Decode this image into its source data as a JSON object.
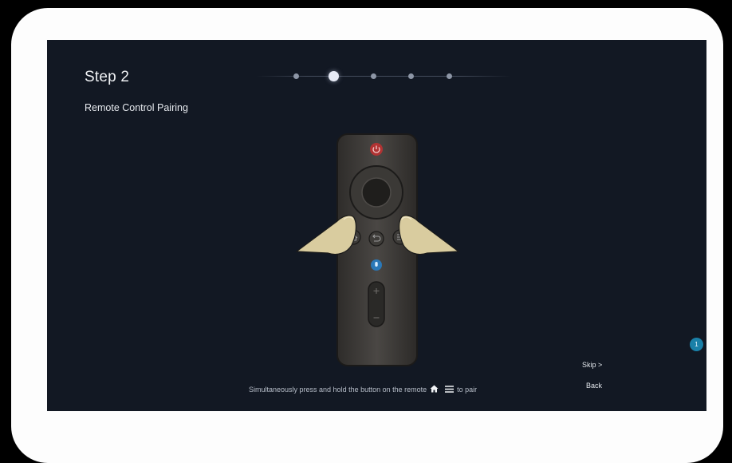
{
  "setup": {
    "title": "Step 2",
    "subtitle": "Remote Control Pairing",
    "progress": {
      "current_step": 2,
      "total_steps": 5
    },
    "instruction": {
      "before": "Simultaneously press and hold the button on the remote",
      "icons": [
        "home-icon",
        "menu-icon"
      ],
      "after": "to pair"
    },
    "skip_label": "Skip >",
    "back_label": "Back"
  },
  "notification": {
    "count": "1"
  },
  "colors": {
    "screen_bg": "#121823",
    "frame": "#fdfdfd",
    "power_button": "#b03333",
    "mic_button": "#2a78b8",
    "badge": "#1a80a8"
  }
}
